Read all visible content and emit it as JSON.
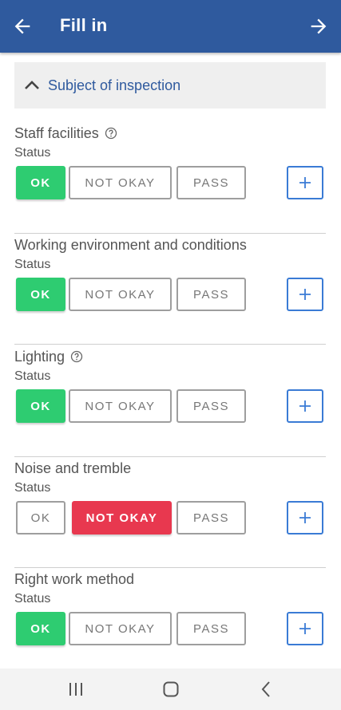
{
  "header": {
    "title": "Fill in",
    "back_icon": "arrow-left-icon",
    "forward_icon": "arrow-right-icon"
  },
  "section": {
    "label": "Subject of inspection",
    "icon": "chevron-up-icon"
  },
  "labels": {
    "status": "Status",
    "ok": "OK",
    "not_okay": "NOT OKAY",
    "pass": "PASS"
  },
  "items": [
    {
      "name": "Staff facilities",
      "has_help": true,
      "selected": "ok"
    },
    {
      "name": "Working environment and conditions",
      "has_help": false,
      "selected": "ok"
    },
    {
      "name": "Lighting",
      "has_help": true,
      "selected": "ok"
    },
    {
      "name": "Noise and tremble",
      "has_help": false,
      "selected": "not_okay"
    },
    {
      "name": "Right work method",
      "has_help": false,
      "selected": "ok"
    }
  ],
  "colors": {
    "appbar": "#2f5a9e",
    "ok": "#2ecc71",
    "not_okay": "#e8384f",
    "plus_border": "#3a7bd5"
  },
  "navbar": {
    "icons": [
      "recent-apps-icon",
      "home-icon",
      "back-icon"
    ]
  }
}
